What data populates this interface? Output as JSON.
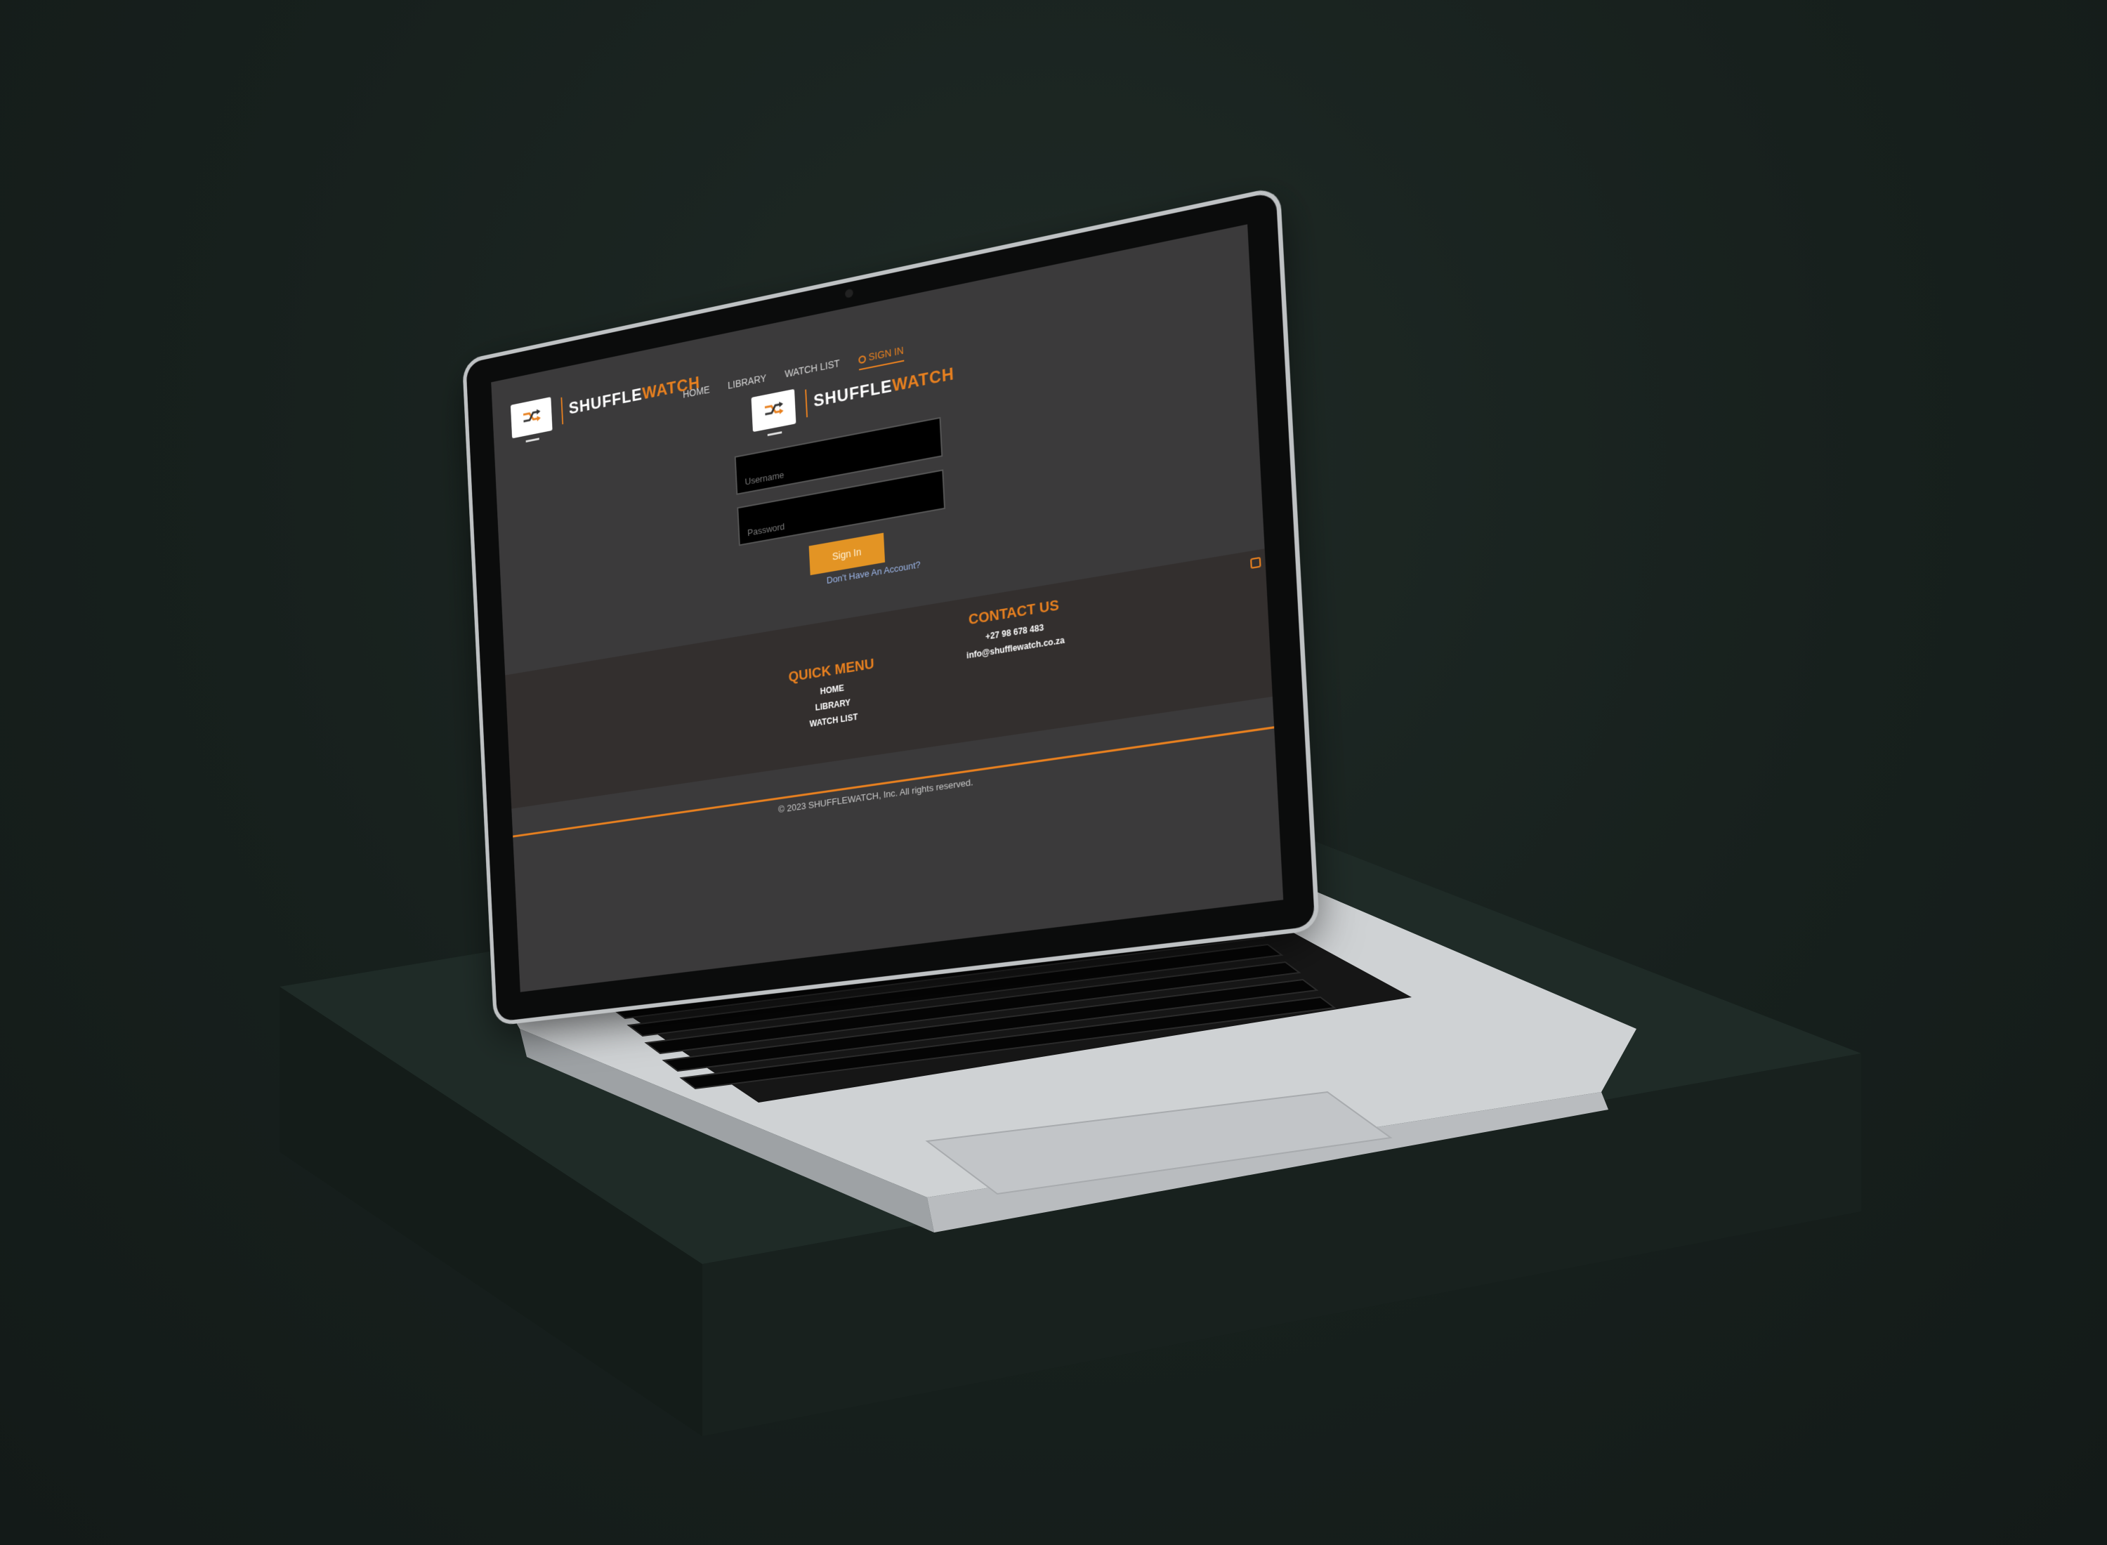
{
  "app": {
    "brand_part1": "SHUFFLE",
    "brand_part2": "WATCH"
  },
  "nav": {
    "items": [
      {
        "label": "HOME"
      },
      {
        "label": "LIBRARY"
      },
      {
        "label": "WATCH LIST"
      },
      {
        "label": "SIGN IN",
        "active": true
      }
    ]
  },
  "login": {
    "username_placeholder": "Username",
    "password_placeholder": "Password",
    "submit_label": "Sign In",
    "register_link": "Don't Have An Account?"
  },
  "footer": {
    "quick_menu_title": "QUICK MENU",
    "quick_menu_items": [
      {
        "label": "HOME"
      },
      {
        "label": "LIBRARY"
      },
      {
        "label": "WATCH LIST"
      }
    ],
    "contact_title": "CONTACT US",
    "contact_phone": "+27 98 678 483",
    "contact_email": "info@shufflewatch.co.za",
    "copyright": "© 2023 SHUFFLEWATCH, Inc. All rights reserved."
  },
  "colors": {
    "accent": "#e8801f",
    "button": "#e39424",
    "page_bg": "#3b3a3b",
    "footer_bg": "#332f2e",
    "scene_bg": "#17201d"
  }
}
